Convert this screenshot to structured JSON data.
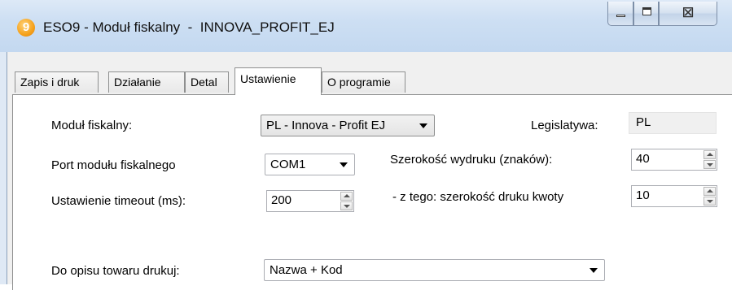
{
  "window": {
    "app_icon_glyph": "9",
    "title": "ESO9 - Moduł fiskalny  -  INNOVA_PROFIT_EJ",
    "minimize_icon": "minimize-icon",
    "maximize_icon": "maximize-icon",
    "close_glyph": "☒"
  },
  "tabs": [
    {
      "label": "Zapis i druk",
      "active": false
    },
    {
      "label": "Działanie",
      "active": false
    },
    {
      "label": "Detal",
      "active": false
    },
    {
      "label": "Ustawienie",
      "active": true
    },
    {
      "label": "O programie",
      "active": false
    }
  ],
  "settings": {
    "modul_fiskalny": {
      "label": "Moduł fiskalny:",
      "value": "PL - Innova - Profit EJ"
    },
    "legislatywa": {
      "label": "Legislatywa:",
      "value": "PL"
    },
    "port": {
      "label": "Port modułu fiskalnego",
      "value": "COM1"
    },
    "szerokosc": {
      "label": "Szerokość wydruku (znaków):",
      "value": "40"
    },
    "timeout": {
      "label": "Ustawienie timeout (ms):",
      "value": "200"
    },
    "szerokosc_kwoty": {
      "label": " - z tego: szerokość druku kwoty",
      "value": "10"
    },
    "opis_towaru": {
      "label": "Do opisu towaru drukuj:",
      "value": "Nazwa + Kod"
    }
  },
  "colors": {
    "titlebar": "#c3d8f0",
    "panel": "#ffffff",
    "chrome": "#f0f0f0"
  }
}
